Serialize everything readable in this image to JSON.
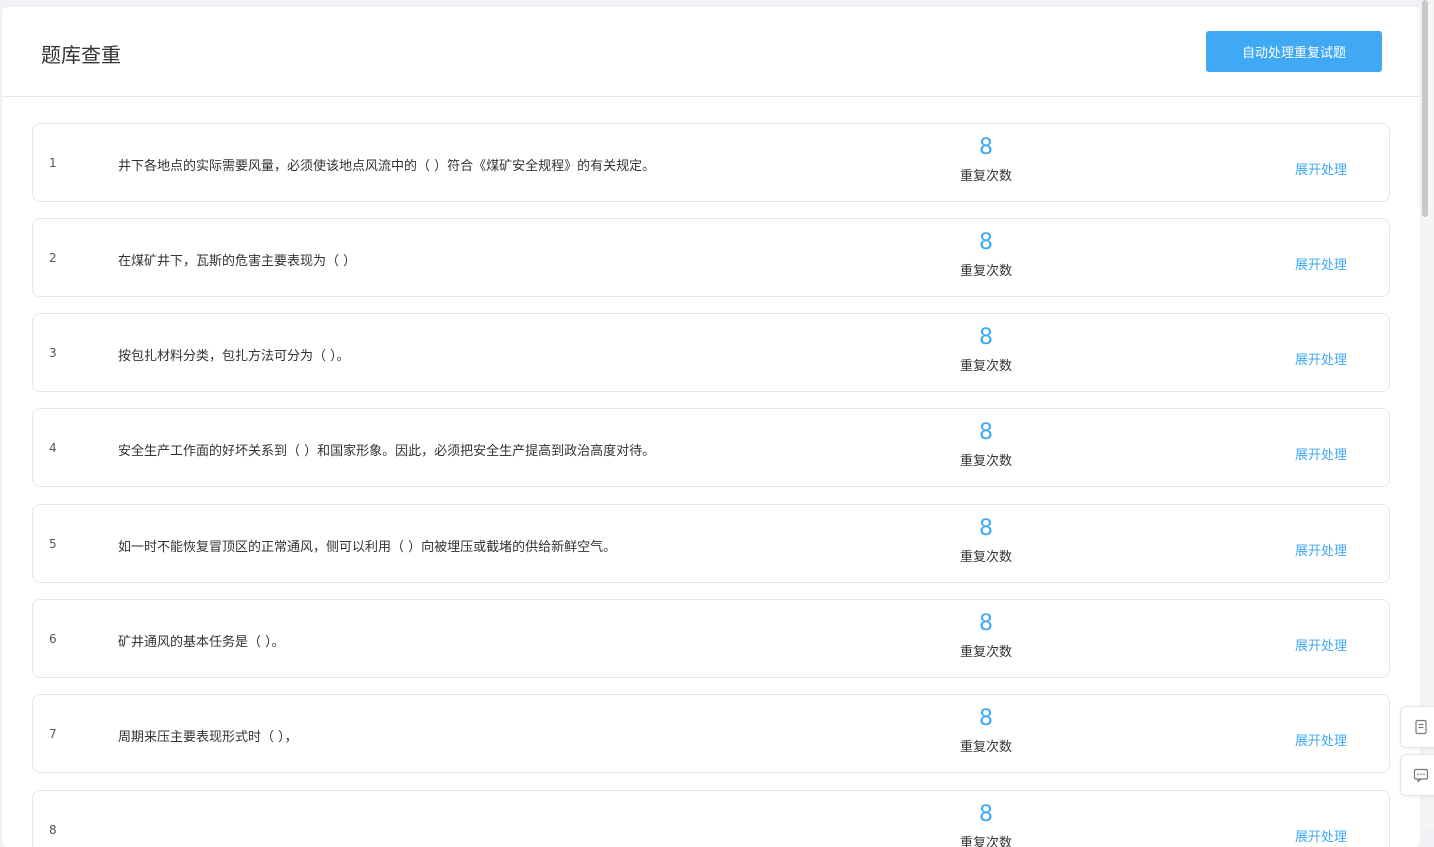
{
  "header": {
    "title": "题库查重",
    "auto_button_label": "自动处理重复试题"
  },
  "count_label": "重复次数",
  "action_label": "展开处理",
  "rows": [
    {
      "index": "1",
      "text": "井下各地点的实际需要风量，必须使该地点风流中的（ ）符合《煤矿安全规程》的有关规定。",
      "count": "8"
    },
    {
      "index": "2",
      "text": "在煤矿井下，瓦斯的危害主要表现为（ ）",
      "count": "8"
    },
    {
      "index": "3",
      "text": "按包扎材料分类，包扎方法可分为（ ）。",
      "count": "8"
    },
    {
      "index": "4",
      "text": "安全生产工作面的好坏关系到（ ）和国家形象。因此，必须把安全生产提高到政治高度对待。",
      "count": "8"
    },
    {
      "index": "5",
      "text": "如一时不能恢复冒顶区的正常通风，侧可以利用（ ）向被埋压或截堵的供给新鲜空气。",
      "count": "8"
    },
    {
      "index": "6",
      "text": "矿井通风的基本任务是（ ）。",
      "count": "8"
    },
    {
      "index": "7",
      "text": "周期来压主要表现形式时（ ），",
      "count": "8"
    },
    {
      "index": "8",
      "text": "",
      "count": "8"
    }
  ],
  "icons": {
    "float_top": "document-icon",
    "float_bottom": "chat-icon"
  },
  "colors": {
    "accent": "#3fa9f5",
    "border": "#e4e7ed",
    "background": "#f0f2f5"
  }
}
